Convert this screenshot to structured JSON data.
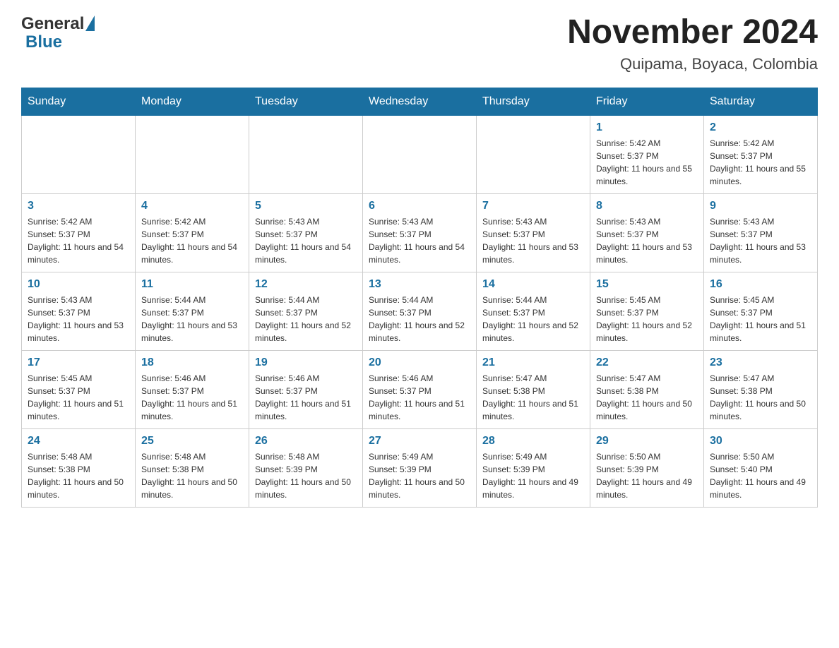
{
  "header": {
    "logo_general": "General",
    "logo_blue": "Blue",
    "title": "November 2024",
    "subtitle": "Quipama, Boyaca, Colombia"
  },
  "weekdays": [
    "Sunday",
    "Monday",
    "Tuesday",
    "Wednesday",
    "Thursday",
    "Friday",
    "Saturday"
  ],
  "weeks": [
    [
      {
        "day": "",
        "info": ""
      },
      {
        "day": "",
        "info": ""
      },
      {
        "day": "",
        "info": ""
      },
      {
        "day": "",
        "info": ""
      },
      {
        "day": "",
        "info": ""
      },
      {
        "day": "1",
        "info": "Sunrise: 5:42 AM\nSunset: 5:37 PM\nDaylight: 11 hours and 55 minutes."
      },
      {
        "day": "2",
        "info": "Sunrise: 5:42 AM\nSunset: 5:37 PM\nDaylight: 11 hours and 55 minutes."
      }
    ],
    [
      {
        "day": "3",
        "info": "Sunrise: 5:42 AM\nSunset: 5:37 PM\nDaylight: 11 hours and 54 minutes."
      },
      {
        "day": "4",
        "info": "Sunrise: 5:42 AM\nSunset: 5:37 PM\nDaylight: 11 hours and 54 minutes."
      },
      {
        "day": "5",
        "info": "Sunrise: 5:43 AM\nSunset: 5:37 PM\nDaylight: 11 hours and 54 minutes."
      },
      {
        "day": "6",
        "info": "Sunrise: 5:43 AM\nSunset: 5:37 PM\nDaylight: 11 hours and 54 minutes."
      },
      {
        "day": "7",
        "info": "Sunrise: 5:43 AM\nSunset: 5:37 PM\nDaylight: 11 hours and 53 minutes."
      },
      {
        "day": "8",
        "info": "Sunrise: 5:43 AM\nSunset: 5:37 PM\nDaylight: 11 hours and 53 minutes."
      },
      {
        "day": "9",
        "info": "Sunrise: 5:43 AM\nSunset: 5:37 PM\nDaylight: 11 hours and 53 minutes."
      }
    ],
    [
      {
        "day": "10",
        "info": "Sunrise: 5:43 AM\nSunset: 5:37 PM\nDaylight: 11 hours and 53 minutes."
      },
      {
        "day": "11",
        "info": "Sunrise: 5:44 AM\nSunset: 5:37 PM\nDaylight: 11 hours and 53 minutes."
      },
      {
        "day": "12",
        "info": "Sunrise: 5:44 AM\nSunset: 5:37 PM\nDaylight: 11 hours and 52 minutes."
      },
      {
        "day": "13",
        "info": "Sunrise: 5:44 AM\nSunset: 5:37 PM\nDaylight: 11 hours and 52 minutes."
      },
      {
        "day": "14",
        "info": "Sunrise: 5:44 AM\nSunset: 5:37 PM\nDaylight: 11 hours and 52 minutes."
      },
      {
        "day": "15",
        "info": "Sunrise: 5:45 AM\nSunset: 5:37 PM\nDaylight: 11 hours and 52 minutes."
      },
      {
        "day": "16",
        "info": "Sunrise: 5:45 AM\nSunset: 5:37 PM\nDaylight: 11 hours and 51 minutes."
      }
    ],
    [
      {
        "day": "17",
        "info": "Sunrise: 5:45 AM\nSunset: 5:37 PM\nDaylight: 11 hours and 51 minutes."
      },
      {
        "day": "18",
        "info": "Sunrise: 5:46 AM\nSunset: 5:37 PM\nDaylight: 11 hours and 51 minutes."
      },
      {
        "day": "19",
        "info": "Sunrise: 5:46 AM\nSunset: 5:37 PM\nDaylight: 11 hours and 51 minutes."
      },
      {
        "day": "20",
        "info": "Sunrise: 5:46 AM\nSunset: 5:37 PM\nDaylight: 11 hours and 51 minutes."
      },
      {
        "day": "21",
        "info": "Sunrise: 5:47 AM\nSunset: 5:38 PM\nDaylight: 11 hours and 51 minutes."
      },
      {
        "day": "22",
        "info": "Sunrise: 5:47 AM\nSunset: 5:38 PM\nDaylight: 11 hours and 50 minutes."
      },
      {
        "day": "23",
        "info": "Sunrise: 5:47 AM\nSunset: 5:38 PM\nDaylight: 11 hours and 50 minutes."
      }
    ],
    [
      {
        "day": "24",
        "info": "Sunrise: 5:48 AM\nSunset: 5:38 PM\nDaylight: 11 hours and 50 minutes."
      },
      {
        "day": "25",
        "info": "Sunrise: 5:48 AM\nSunset: 5:38 PM\nDaylight: 11 hours and 50 minutes."
      },
      {
        "day": "26",
        "info": "Sunrise: 5:48 AM\nSunset: 5:39 PM\nDaylight: 11 hours and 50 minutes."
      },
      {
        "day": "27",
        "info": "Sunrise: 5:49 AM\nSunset: 5:39 PM\nDaylight: 11 hours and 50 minutes."
      },
      {
        "day": "28",
        "info": "Sunrise: 5:49 AM\nSunset: 5:39 PM\nDaylight: 11 hours and 49 minutes."
      },
      {
        "day": "29",
        "info": "Sunrise: 5:50 AM\nSunset: 5:39 PM\nDaylight: 11 hours and 49 minutes."
      },
      {
        "day": "30",
        "info": "Sunrise: 5:50 AM\nSunset: 5:40 PM\nDaylight: 11 hours and 49 minutes."
      }
    ]
  ]
}
